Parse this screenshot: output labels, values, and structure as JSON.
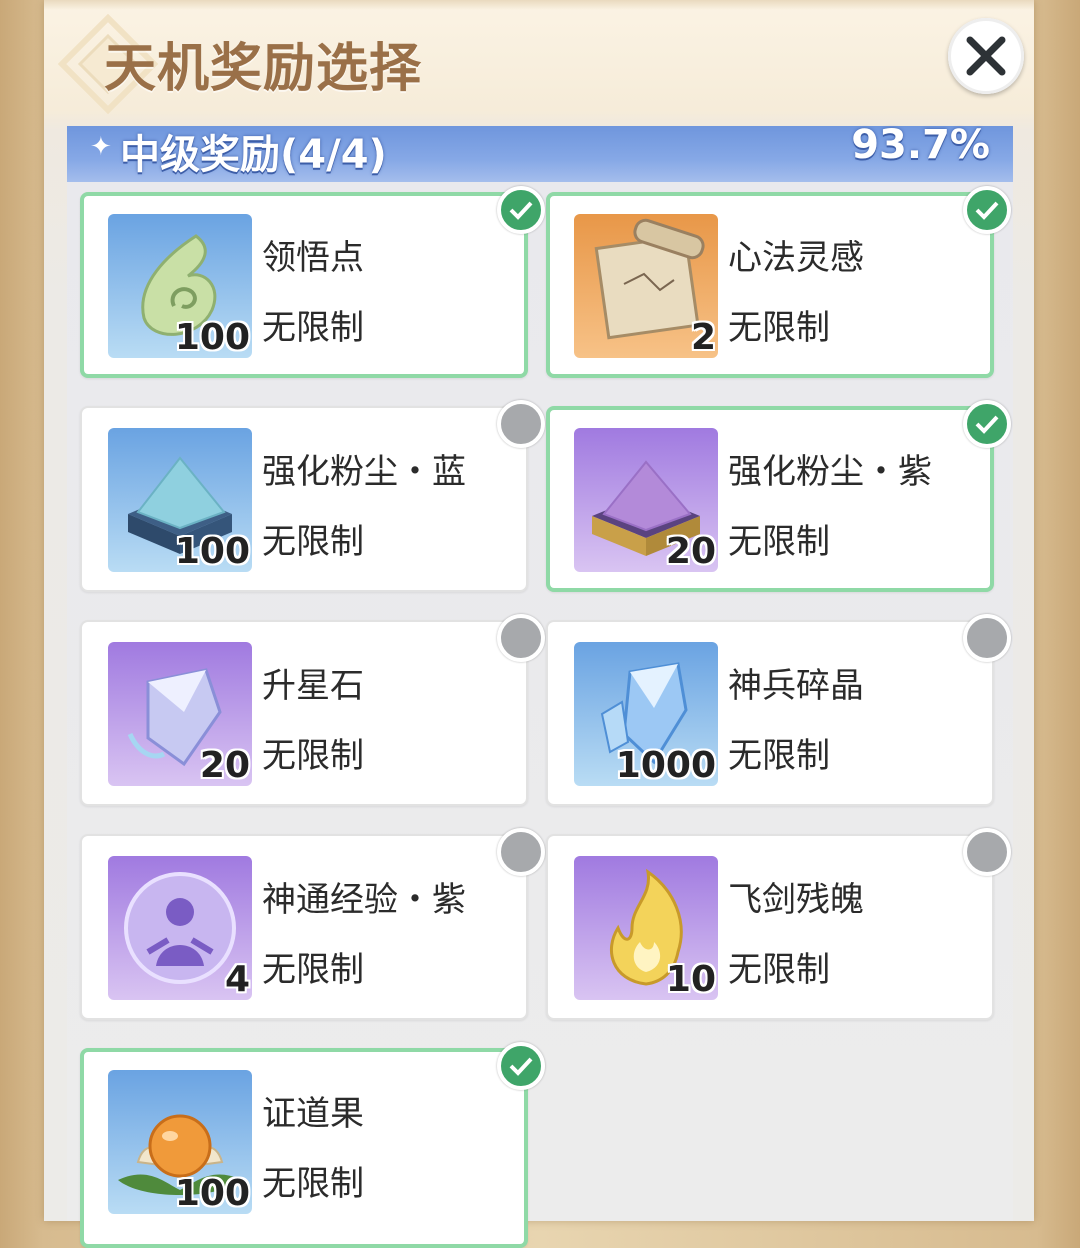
{
  "dialog": {
    "title": "天机奖励选择",
    "close_icon": "close-icon"
  },
  "section": {
    "title": "中级奖励(4/4)",
    "percent": "93.7%",
    "accent_color": "#7aa0e2"
  },
  "rewards": [
    {
      "name": "领悟点",
      "quantity": "100",
      "limit": "无限制",
      "selected": true,
      "icon": "green-jade-drop-icon"
    },
    {
      "name": "心法灵感",
      "quantity": "2",
      "limit": "无限制",
      "selected": true,
      "icon": "scroll-icon"
    },
    {
      "name": "强化粉尘・蓝",
      "quantity": "100",
      "limit": "无限制",
      "selected": false,
      "icon": "blue-dust-box-icon"
    },
    {
      "name": "强化粉尘・紫",
      "quantity": "20",
      "limit": "无限制",
      "selected": true,
      "icon": "purple-dust-box-icon"
    },
    {
      "name": "升星石",
      "quantity": "20",
      "limit": "无限制",
      "selected": false,
      "icon": "purple-crystal-icon"
    },
    {
      "name": "神兵碎晶",
      "quantity": "1000",
      "limit": "无限制",
      "selected": false,
      "icon": "blue-crystal-icon"
    },
    {
      "name": "神通经验・紫",
      "quantity": "4",
      "limit": "无限制",
      "selected": false,
      "icon": "spirit-orb-icon"
    },
    {
      "name": "飞剑残魄",
      "quantity": "10",
      "limit": "无限制",
      "selected": false,
      "icon": "golden-flame-icon"
    },
    {
      "name": "证道果",
      "quantity": "100",
      "limit": "无限制",
      "selected": true,
      "icon": "lotus-fruit-icon"
    }
  ],
  "colors": {
    "selected_border": "#8fd9a6",
    "check_green": "#3fa569",
    "unselected_radio": "#a7a9ac",
    "title_brown": "#9a7048"
  }
}
